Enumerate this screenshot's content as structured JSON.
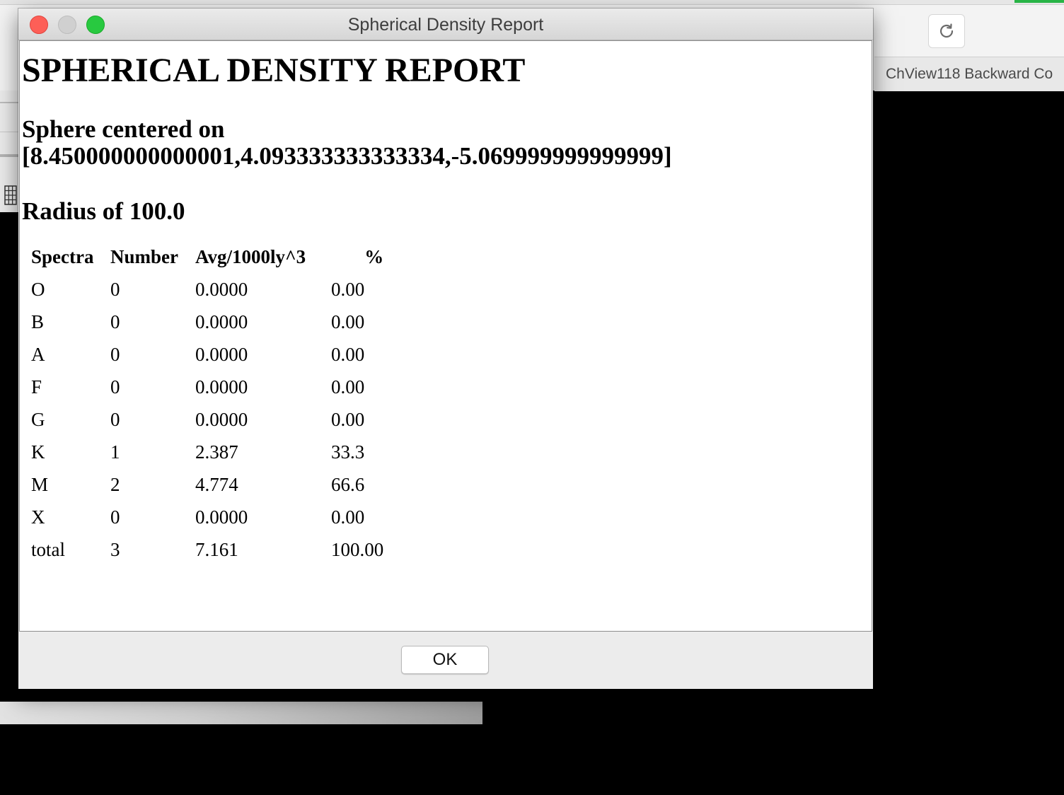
{
  "background_app": {
    "tab_label": "ChView118 Backward Co",
    "reload_icon": "reload-icon",
    "grid_icon": "grid-icon",
    "accent_color": "#28b446"
  },
  "dialog": {
    "window_title": "Spherical Density Report",
    "report_title": "SPHERICAL DENSITY REPORT",
    "sphere_label": "Sphere centered on",
    "sphere_coords": "[8.450000000000001,4.093333333333334,-5.069999999999999]",
    "radius_text": "Radius of 100.0",
    "table": {
      "headers": [
        "Spectra",
        "Number",
        "Avg/1000ly^3",
        "%"
      ],
      "rows": [
        [
          "O",
          "0",
          "0.0000",
          "0.00"
        ],
        [
          "B",
          "0",
          "0.0000",
          "0.00"
        ],
        [
          "A",
          "0",
          "0.0000",
          "0.00"
        ],
        [
          "F",
          "0",
          "0.0000",
          "0.00"
        ],
        [
          "G",
          "0",
          "0.0000",
          "0.00"
        ],
        [
          "K",
          "1",
          "2.387",
          "33.3"
        ],
        [
          "M",
          "2",
          "4.774",
          "66.6"
        ],
        [
          "X",
          "0",
          "0.0000",
          "0.00"
        ],
        [
          "total",
          "3",
          "7.161",
          "100.00"
        ]
      ]
    },
    "ok_label": "OK",
    "colors": {
      "close": "#fd5f57",
      "minimize": "#d0d0d0",
      "zoom": "#28c940"
    }
  }
}
